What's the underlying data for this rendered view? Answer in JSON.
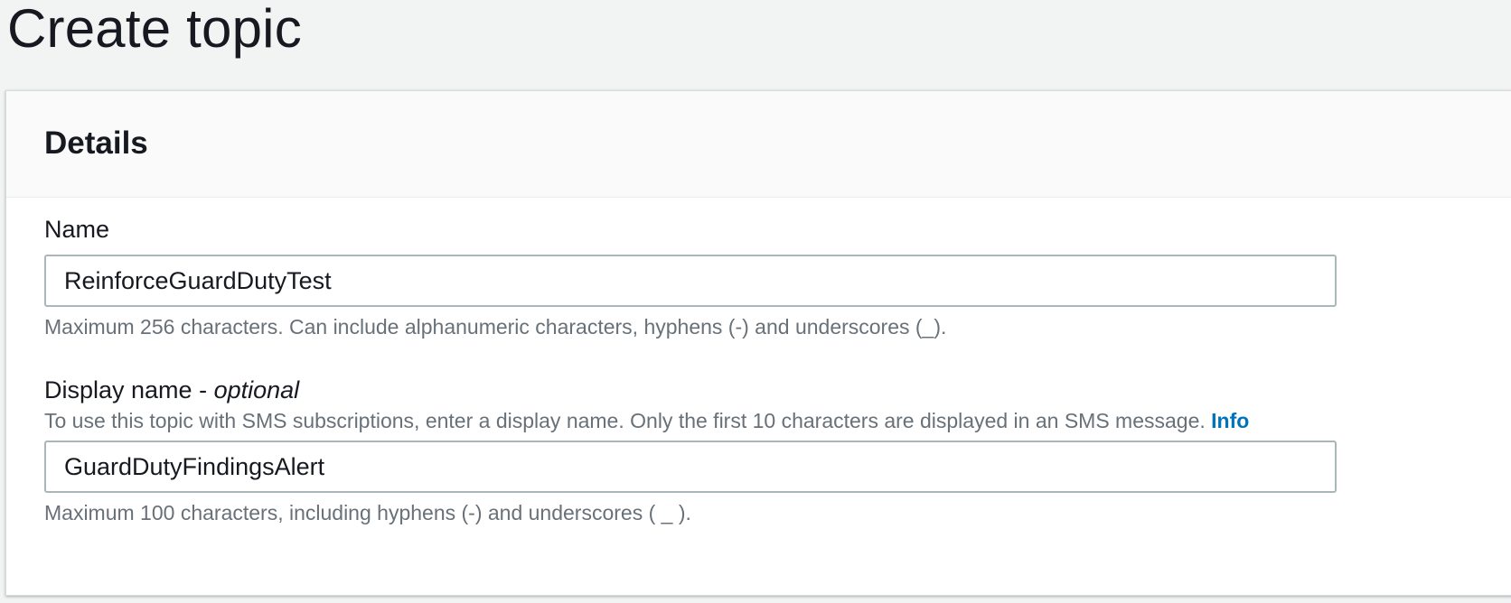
{
  "page": {
    "title": "Create topic"
  },
  "details": {
    "title": "Details",
    "name": {
      "label": "Name",
      "value": "ReinforceGuardDutyTest",
      "hint": "Maximum 256 characters. Can include alphanumeric characters, hyphens (-) and underscores (_)."
    },
    "display_name": {
      "label": "Display name - ",
      "optional": "optional",
      "description": "To use this topic with SMS subscriptions, enter a display name. Only the first 10 characters are displayed in an SMS message.",
      "info_link": "Info",
      "value": "GuardDutyFindingsAlert",
      "hint": "Maximum 100 characters, including hyphens (-) and underscores ( _ )."
    }
  },
  "colors": {
    "page_bg": "#f2f3f3",
    "panel_header_bg": "#fafafa",
    "link": "#0073bb",
    "hint_text": "#687078",
    "input_border": "#aab7b8"
  }
}
